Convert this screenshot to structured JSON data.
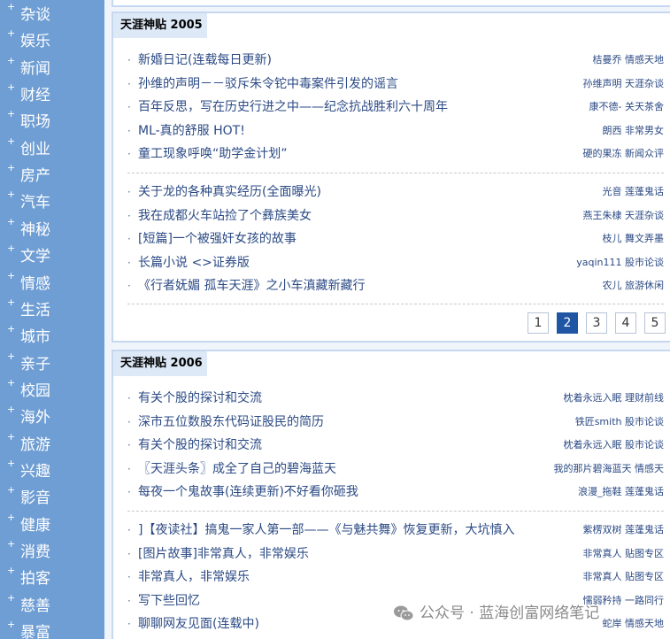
{
  "sidebar": {
    "plus": "+",
    "items": [
      "杂谈",
      "娱乐",
      "新闻",
      "财经",
      "职场",
      "创业",
      "房产",
      "汽车",
      "神秘",
      "文学",
      "情感",
      "生活",
      "城市",
      "亲子",
      "校园",
      "海外",
      "旅游",
      "兴趣",
      "影音",
      "健康",
      "消费",
      "拍客",
      "慈善",
      "暴富"
    ]
  },
  "section2005": {
    "title": "天涯神贴 2005",
    "bullet": "·",
    "groupA": [
      {
        "title": "新婚日记(连载每日更新)",
        "meta": "桔曼乔 情感天地"
      },
      {
        "title": "孙维的声明－－驳斥朱令铊中毒案件引发的谣言",
        "meta": "孙维声明 天涯杂谈"
      },
      {
        "title": "百年反思，写在历史行进之中——纪念抗战胜利六十周年",
        "meta": "康不德- 关天茶舍"
      },
      {
        "title": "ML-真的舒服 HOT!",
        "meta": "朗西 非常男女"
      },
      {
        "title": "童工现象呼唤“助学金计划”",
        "meta": "硬的果冻 新闻众评"
      }
    ],
    "groupB": [
      {
        "title": "关于龙的各种真实经历(全面曝光)",
        "meta": "光音 莲蓬鬼话"
      },
      {
        "title": "我在成都火车站捡了个彝族美女",
        "meta": "燕王朱棣 天涯杂谈"
      },
      {
        "title": "[短篇]一个被强奸女孩的故事",
        "meta": "枝儿 舞文弄墨"
      },
      {
        "title": "长篇小说 <>证券版",
        "meta": "yaqin111 股市论谈"
      },
      {
        "title": "《行者妩媚 孤车天涯》之小车滇藏新藏行",
        "meta": "农儿 旅游休闲"
      }
    ],
    "pager": {
      "pages": [
        "1",
        "2",
        "3",
        "4",
        "5"
      ],
      "active": "2"
    }
  },
  "section2006": {
    "title": "天涯神贴 2006",
    "bullet": "·",
    "groupA": [
      {
        "title": "有关个股的探讨和交流",
        "meta": "枕着永远入眠 理财前线"
      },
      {
        "title": "深市五位数股东代码证股民的简历",
        "meta": "铁匠smith 股市论谈"
      },
      {
        "title": "有关个股的探讨和交流",
        "meta": "枕着永远入眠 股市论谈"
      },
      {
        "title": "〖天涯头条〗成全了自己的碧海蓝天",
        "meta": "我的那片碧海蓝天 情感天"
      },
      {
        "title": "每夜一个鬼故事(连续更新)不好看你砸我",
        "meta": "浪漫_拖鞋 莲蓬鬼话"
      }
    ],
    "groupB": [
      {
        "title": "]【夜读社】搞鬼一家人第一部——《与魅共舞》恢复更新，大坑慎入",
        "meta": "紫楞双树 莲蓬鬼话"
      },
      {
        "title": "[图片故事]非常真人，非常娱乐",
        "meta": "非常真人 贴图专区"
      },
      {
        "title": "非常真人，非常娱乐",
        "meta": "非常真人 贴图专区"
      },
      {
        "title": "写下些回忆",
        "meta": "懦弱矜持 一路同行"
      },
      {
        "title": "聊聊网友见面(连载中)",
        "meta": "蛇岸 情感天地"
      }
    ]
  },
  "watermark": {
    "text": "公众号 · 蓝海创富网络笔记",
    "icon": "wechat-icon"
  }
}
